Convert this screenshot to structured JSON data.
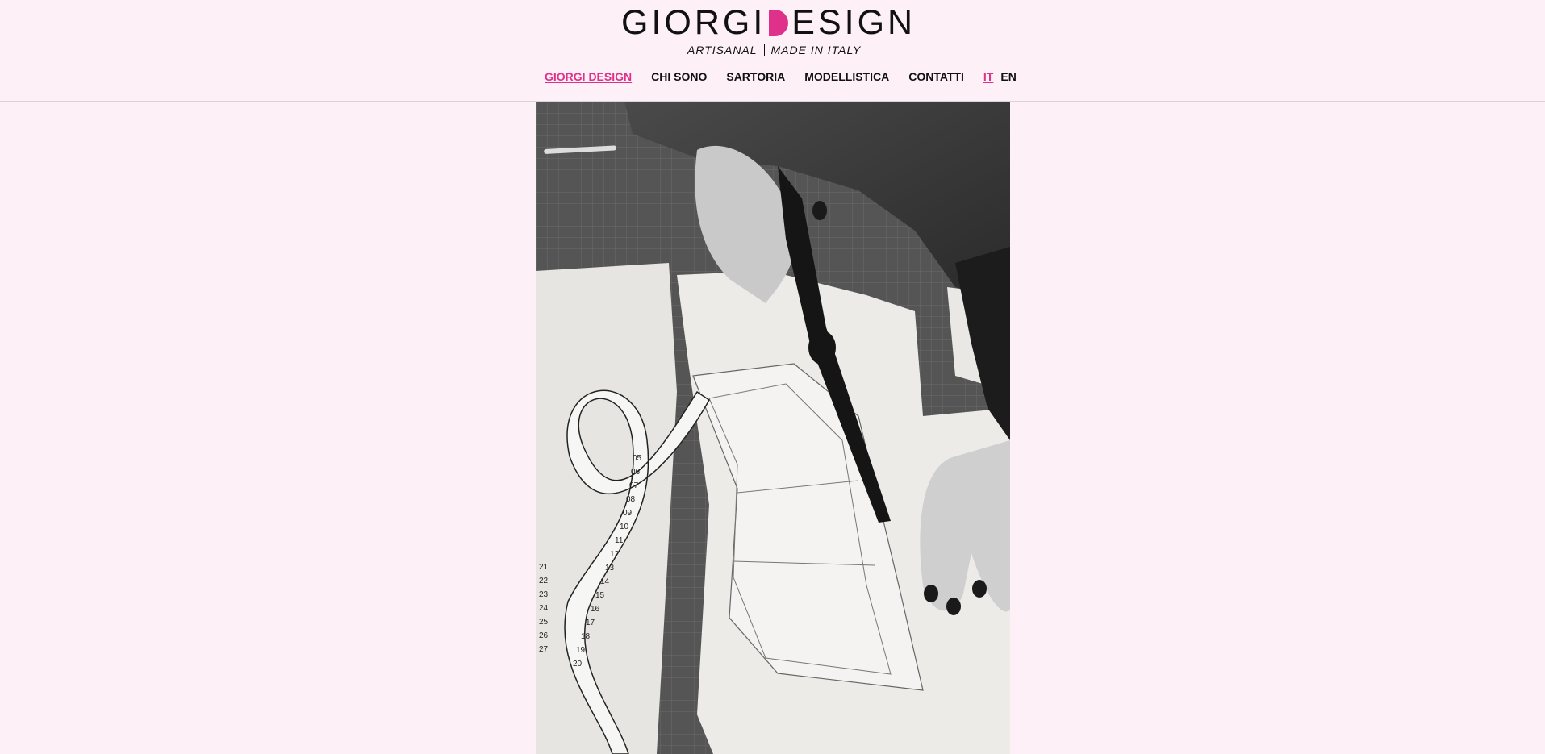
{
  "logo": {
    "word_left": "GIORGI",
    "word_right": "ESIGN",
    "tagline_left": "ARTISANAL",
    "tagline_right": "MADE IN ITALY",
    "accent_color": "#e0318a"
  },
  "nav": {
    "items": [
      {
        "label": "GIORGI DESIGN",
        "active": true
      },
      {
        "label": "CHI SONO",
        "active": false
      },
      {
        "label": "SARTORIA",
        "active": false
      },
      {
        "label": "MODELLISTICA",
        "active": false
      },
      {
        "label": "CONTATTI",
        "active": false
      }
    ],
    "languages": [
      {
        "label": "IT",
        "active": true
      },
      {
        "label": "EN",
        "active": false
      }
    ]
  },
  "hero": {
    "image": "black-and-white photo of hands cutting a fabric pattern with scissors beside a measuring tape",
    "tape_numbers": [
      "05",
      "06",
      "07",
      "08",
      "09",
      "10",
      "11",
      "12",
      "13",
      "14",
      "15",
      "16",
      "17",
      "18",
      "19",
      "20",
      "21",
      "22",
      "23",
      "24",
      "25",
      "26",
      "27"
    ]
  },
  "colors": {
    "background": "#fdf0f7",
    "text": "#111111",
    "accent": "#e0318a"
  }
}
